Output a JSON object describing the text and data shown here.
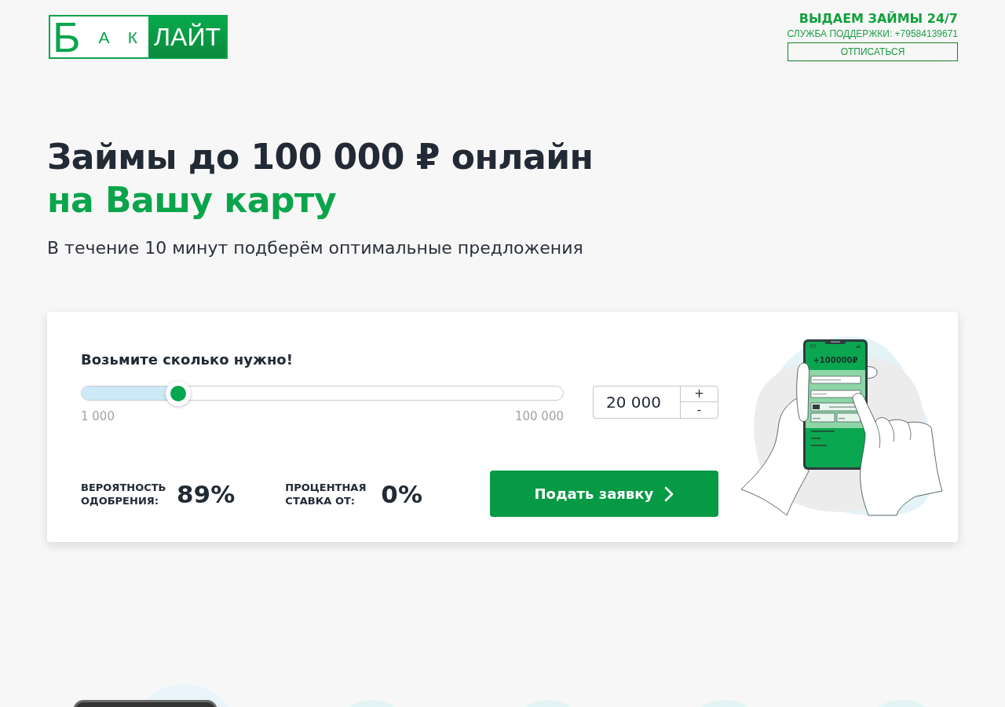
{
  "header": {
    "logo": {
      "letters": [
        "Б",
        "А",
        "К"
      ],
      "word": "ЛАЙТ"
    },
    "tagline": "ВЫДАЕМ ЗАЙМЫ 24/7",
    "support": "СЛУЖБА ПОДДЕРЖКИ: +79584139671",
    "unsubscribe_button": "ОТПИСАТЬСЯ"
  },
  "hero": {
    "title": "Займы до 100 000 ₽ онлайн",
    "title_accent": "на Вашу карту",
    "subtitle": "В течение 10 минут подберём оптимальные предложения"
  },
  "calculator": {
    "heading": "Возьмите сколько нужно!",
    "slider": {
      "level": 0.2,
      "min_label": "1 000",
      "max_label": "100 000"
    },
    "amount": {
      "value": "20 000",
      "increase": "+",
      "decrease": "-"
    },
    "stats": [
      {
        "label": "ВЕРОЯТНОСТЬ ОДОБРЕНИЯ:",
        "value": "89%"
      },
      {
        "label": "ПРОЦЕНТНАЯ СТАВКА ОТ:",
        "value": "0%"
      }
    ],
    "submit_button": "Подать заявку",
    "illustration": {
      "amount": "+100000₽"
    }
  }
}
